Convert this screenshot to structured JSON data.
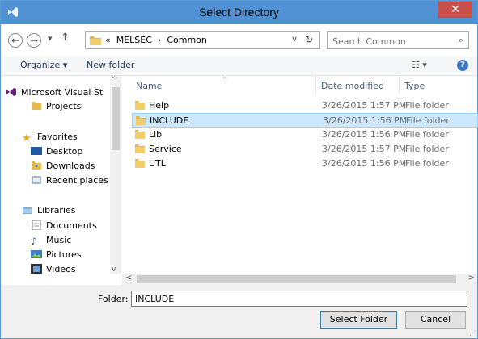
{
  "window": {
    "title": "Select Directory",
    "close_label": "✕"
  },
  "address": {
    "breadcrumb_prefix": "«",
    "crumbs": [
      "MELSEC",
      "Common"
    ],
    "separator": "›"
  },
  "search": {
    "placeholder": "Search Common"
  },
  "toolbar": {
    "organize_label": "Organize ▾",
    "new_folder_label": "New folder",
    "help_label": "?"
  },
  "nav": {
    "items": [
      {
        "label": "Microsoft Visual St",
        "icon": "visual-studio-icon"
      },
      {
        "label": "Projects",
        "icon": "folder-icon"
      },
      {
        "label": "Favorites",
        "icon": "star-icon"
      },
      {
        "label": "Desktop",
        "icon": "desktop-icon"
      },
      {
        "label": "Downloads",
        "icon": "downloads-icon"
      },
      {
        "label": "Recent places",
        "icon": "recent-places-icon"
      },
      {
        "label": "Libraries",
        "icon": "libraries-icon"
      },
      {
        "label": "Documents",
        "icon": "documents-icon"
      },
      {
        "label": "Music",
        "icon": "music-icon"
      },
      {
        "label": "Pictures",
        "icon": "pictures-icon"
      },
      {
        "label": "Videos",
        "icon": "videos-icon"
      }
    ]
  },
  "files": {
    "columns": {
      "name": "Name",
      "date": "Date modified",
      "type": "Type"
    },
    "rows": [
      {
        "name": "Help",
        "date": "3/26/2015 1:57 PM",
        "type": "File folder",
        "selected": false
      },
      {
        "name": "INCLUDE",
        "date": "3/26/2015 1:56 PM",
        "type": "File folder",
        "selected": true
      },
      {
        "name": "Lib",
        "date": "3/26/2015 1:56 PM",
        "type": "File folder",
        "selected": false
      },
      {
        "name": "Service",
        "date": "3/26/2015 1:57 PM",
        "type": "File folder",
        "selected": false
      },
      {
        "name": "UTL",
        "date": "3/26/2015 1:56 PM",
        "type": "File folder",
        "selected": false
      }
    ]
  },
  "bottom": {
    "folder_label": "Folder:",
    "folder_value": "INCLUDE",
    "select_label": "Select Folder",
    "cancel_label": "Cancel"
  },
  "colors": {
    "titlebar": "#4f91d3",
    "close": "#c7504a",
    "selection": "#cce8ff",
    "folder": "#e8b84a"
  }
}
